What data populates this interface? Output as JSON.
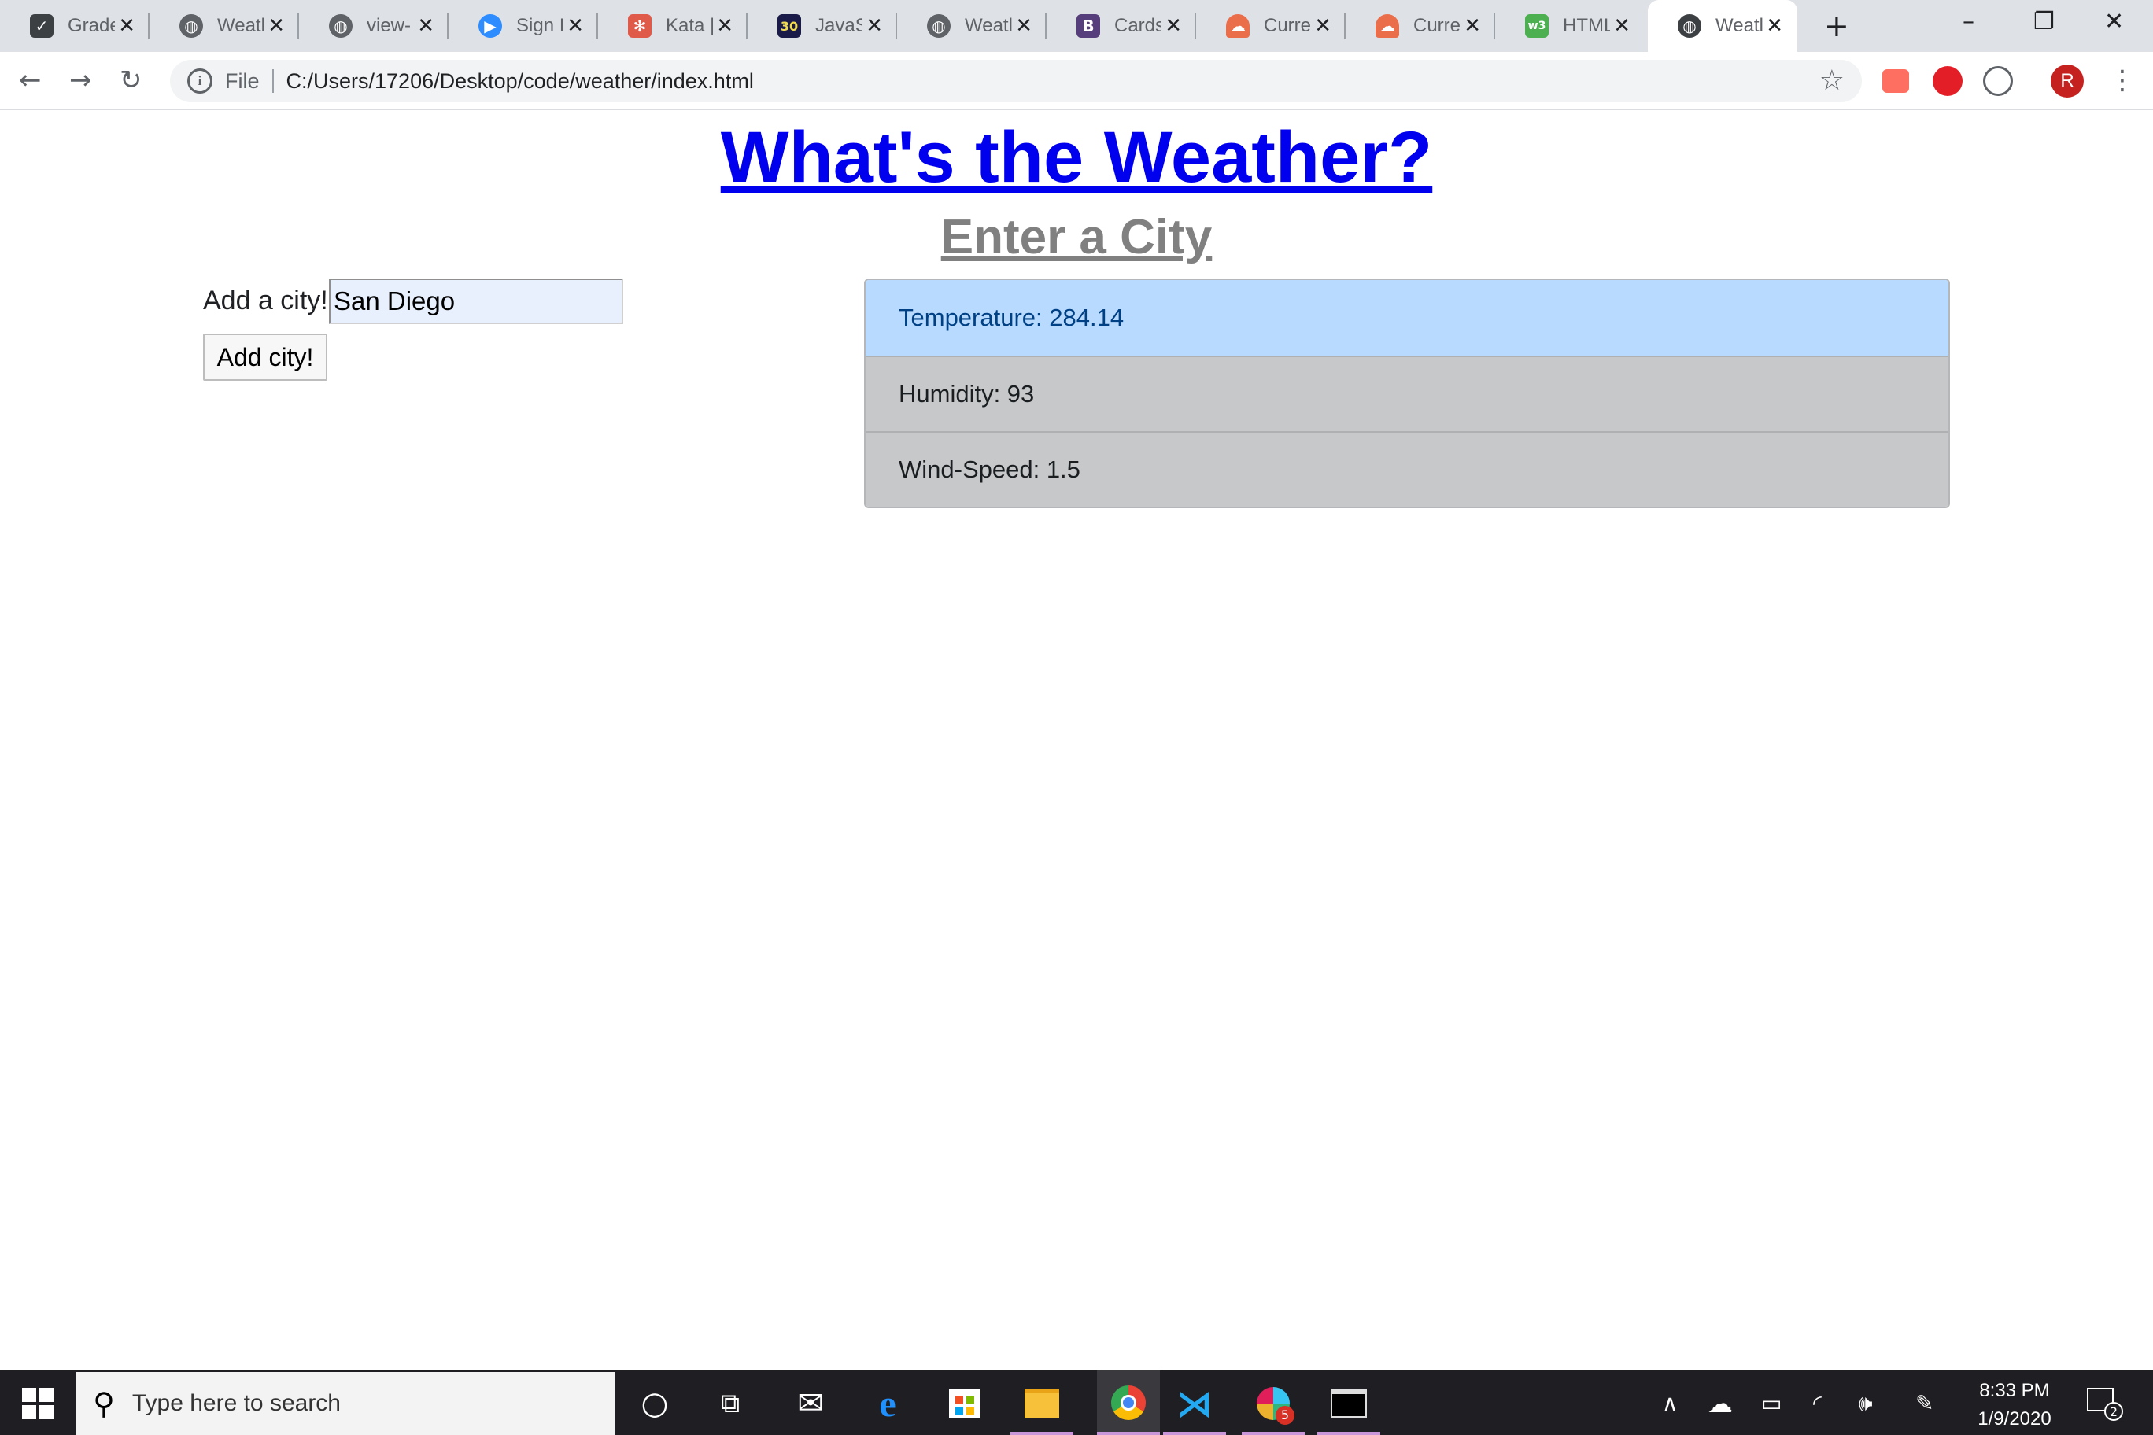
{
  "browser": {
    "tabs": [
      {
        "title": "Grade",
        "icon": "shield-check-icon",
        "color": "#3c4043"
      },
      {
        "title": "Weatl",
        "icon": "globe-icon",
        "color": "#5f6368"
      },
      {
        "title": "view-",
        "icon": "globe-icon",
        "color": "#5f6368"
      },
      {
        "title": "Sign I",
        "icon": "zoom-icon",
        "color": "#2d8cff"
      },
      {
        "title": "Kata |",
        "icon": "codewars-icon",
        "color": "#e05a4a"
      },
      {
        "title": "JavaS",
        "icon": "javascript30-icon",
        "color": "#1b1b4a"
      },
      {
        "title": "Weatl",
        "icon": "globe-icon",
        "color": "#5f6368"
      },
      {
        "title": "Cards",
        "icon": "bootstrap-icon",
        "color": "#563d7c"
      },
      {
        "title": "Curre",
        "icon": "openweather-icon",
        "color": "#eb6e4b"
      },
      {
        "title": "Curre",
        "icon": "openweather-icon",
        "color": "#eb6e4b"
      },
      {
        "title": "HTML",
        "icon": "w3schools-icon",
        "color": "#4caf50"
      },
      {
        "title": "Weatl",
        "icon": "globe-icon",
        "color": "#5f6368",
        "active": true
      }
    ],
    "new_tab": "+",
    "window_controls": {
      "minimize": "–",
      "restore": "❐",
      "close": "✕"
    },
    "address": {
      "scheme": "File",
      "url": "C:/Users/17206/Desktop/code/weather/index.html"
    },
    "profile_initial": "R"
  },
  "page": {
    "title": "What's the Weather?",
    "subtitle": "Enter a City",
    "form": {
      "label": "Add a city!",
      "input_value": "San Diego",
      "button_label": "Add city!"
    },
    "weather": [
      {
        "label": "Temperature: 284.14"
      },
      {
        "label": "Humidity: 93"
      },
      {
        "label": "Wind-Speed: 1.5"
      }
    ]
  },
  "taskbar": {
    "search_placeholder": "Type here to search",
    "time": "8:33 PM",
    "date": "1/9/2020",
    "slack_badge": "5",
    "notification_count": "2"
  }
}
